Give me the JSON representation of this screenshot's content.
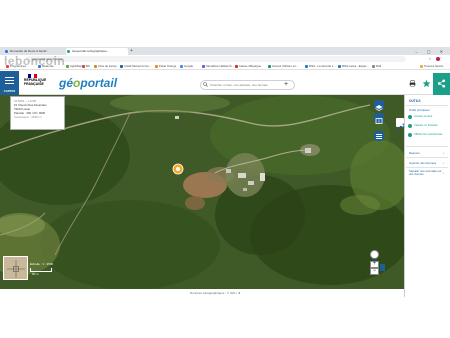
{
  "browser": {
    "tabs": [
      {
        "label": "Demande de Devis à bénéf..."
      },
      {
        "label": "Géoportail cartographique..."
      }
    ],
    "new_tab": "+",
    "window_controls": "‒ ▢ ✕",
    "nav": "← → ↻",
    "url": "geoportail.gouv.fr/carte",
    "right_icons": "☆ ⋮"
  },
  "bookmarks": [
    {
      "label": "Programmes",
      "color": "#e1463e"
    },
    {
      "label": "Météorite",
      "color": "#3d7ad6"
    },
    {
      "label": "Agri&Dep",
      "color": "#5fa63e"
    },
    {
      "label": "BS",
      "color": "#c24a4a"
    },
    {
      "label": "Infos de transp",
      "color": "#d08a2b"
    },
    {
      "label": "Crédit Mutuel du Su...",
      "color": "#1f5f99"
    },
    {
      "label": "Petite Orange",
      "color": "#f08b1d"
    },
    {
      "label": "Google",
      "color": "#4285f4"
    },
    {
      "label": "Sémaflore Habitat Ib...",
      "color": "#6a5acd"
    },
    {
      "label": "Caisse d'Épargne",
      "color": "#d22c2c"
    },
    {
      "label": "Accueil | Moteur en...",
      "color": "#2d8f6f"
    },
    {
      "label": "MSA - La sécurité s...",
      "color": "#2c7cb8"
    },
    {
      "label": "MSA Lanes - Espac...",
      "color": "#2c7cb8"
    },
    {
      "label": "Mail",
      "color": "#888888"
    },
    {
      "label": "Tous les favoris",
      "color": "#e2b33a"
    }
  ],
  "watermark": "leboncoin",
  "header": {
    "menu_label": "CARTES",
    "rf_text": "RÉPUBLIQUE\nFRANÇAISE",
    "logo_a": "gé",
    "logo_o": "o",
    "logo_b": "portail",
    "search_placeholder": "Chercher un lieu, une adresse, une donnée",
    "search_plus": "+"
  },
  "info_popup": {
    "coords": "43.5993 , -1.1238",
    "address": "15 Chemin Des Fleurettes",
    "city": "79010 Lavan",
    "parcel": "Parcelle : 460 / 00 / 0000",
    "contenance": "Contenance : 2158 m²"
  },
  "map": {
    "scale_label": "Échelle : 1 : 2500",
    "scale_value": "50 m",
    "zoom_in": "+",
    "zoom_out": "−",
    "footer": "Données cartographiques : ©   IGN   •   ★"
  },
  "right_panel": {
    "title": "OUTILS",
    "section_1": "Outils principaux",
    "item_1": "Annoter la carte",
    "item_2": "Calculer un itinéraire",
    "item_3": "Afficher les coordonnées",
    "section_2": "Mesures",
    "section_3": "Importer des données",
    "section_4": "Signaler une anomalie sur une donnée",
    "chevron": "›"
  },
  "colors": {
    "brand_blue": "#1f5f99",
    "accent_green": "#1aa08a",
    "logo_blue": "#1f7fc0",
    "logo_green": "#80b53a",
    "marker_orange": "#f5a623"
  }
}
